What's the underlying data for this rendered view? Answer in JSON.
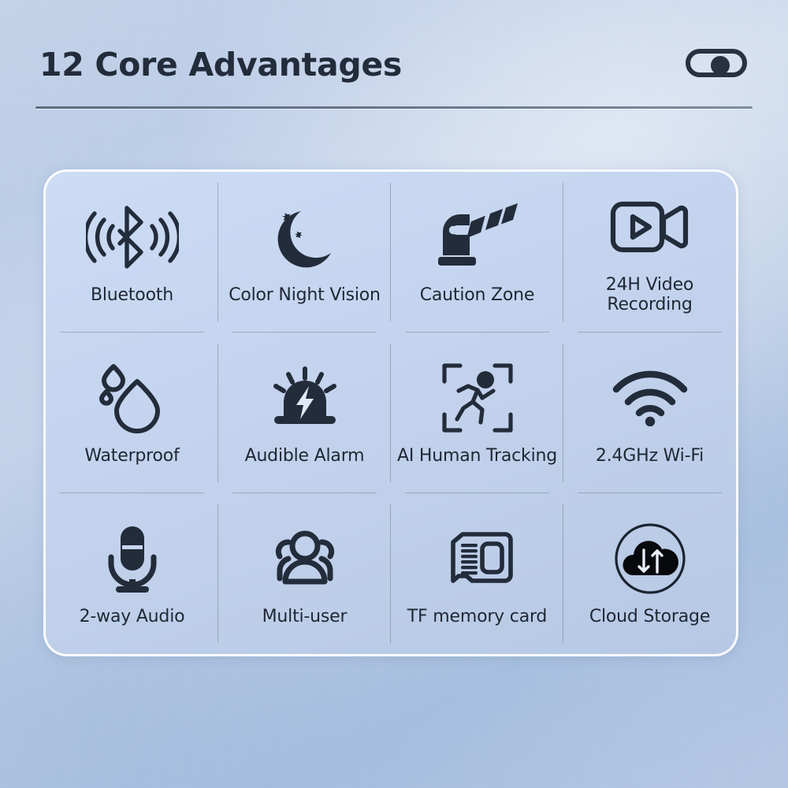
{
  "header": {
    "title": "12 Core Advantages",
    "toggle": {
      "name": "toggle-switch",
      "state": "on"
    }
  },
  "colors": {
    "background_light": "#c9d7ec",
    "background_dark": "#a8c0e0",
    "panel_fill": "#c6d6f0",
    "panel_border": "#ffffff",
    "icon": "#222c3a",
    "text": "#1e2733",
    "divider": "#606e82"
  },
  "panel": {
    "columns": 4,
    "rows": 3,
    "features": [
      {
        "icon": "bluetooth-icon",
        "label": "Bluetooth"
      },
      {
        "icon": "moon-stars-icon",
        "label": "Color Night Vision"
      },
      {
        "icon": "boom-barrier-icon",
        "label": "Caution Zone"
      },
      {
        "icon": "video-camera-icon",
        "label": "24H Video Recording"
      },
      {
        "icon": "water-drops-icon",
        "label": "Waterproof"
      },
      {
        "icon": "siren-alarm-icon",
        "label": "Audible Alarm"
      },
      {
        "icon": "running-person-frame-icon",
        "label": "AI Human Tracking"
      },
      {
        "icon": "wifi-icon",
        "label": "2.4GHz Wi-Fi"
      },
      {
        "icon": "microphone-icon",
        "label": "2-way Audio"
      },
      {
        "icon": "users-group-icon",
        "label": "Multi-user"
      },
      {
        "icon": "memory-card-icon",
        "label": "TF memory card"
      },
      {
        "icon": "cloud-sync-icon",
        "label": "Cloud Storage"
      }
    ]
  }
}
